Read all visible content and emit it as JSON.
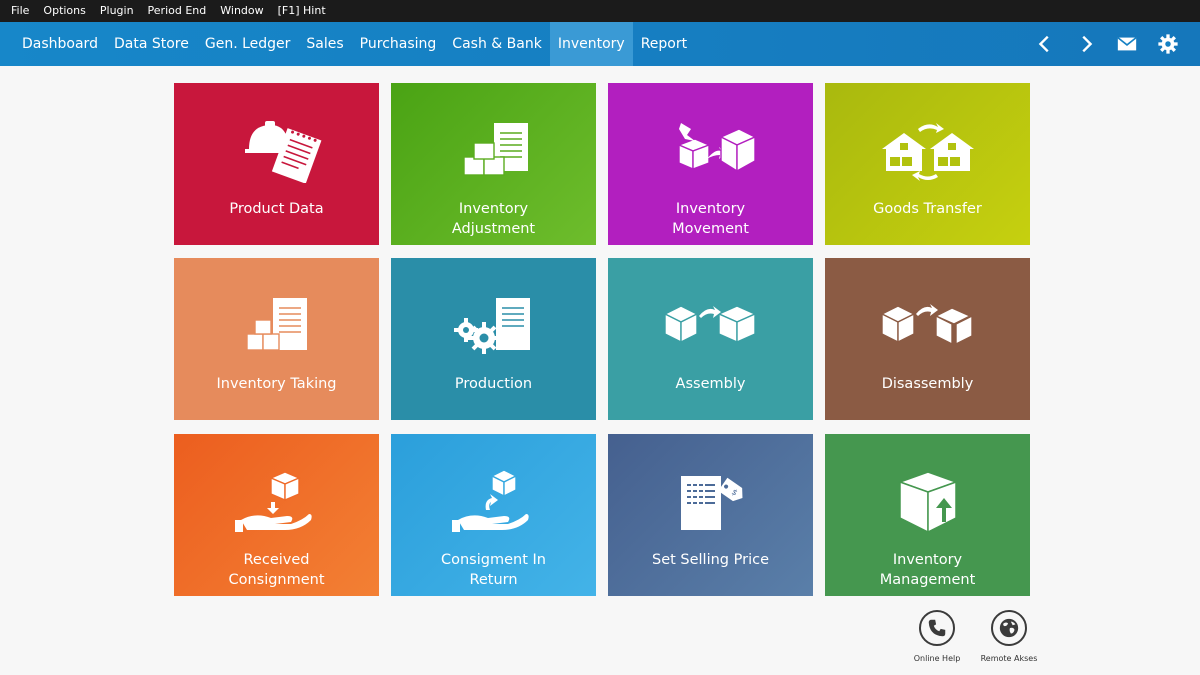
{
  "menubar": {
    "items": [
      "File",
      "Options",
      "Plugin",
      "Period End",
      "Window",
      "[F1] Hint"
    ]
  },
  "navbar": {
    "tabs": [
      "Dashboard",
      "Data Store",
      "Gen. Ledger",
      "Sales",
      "Purchasing",
      "Cash & Bank",
      "Inventory",
      "Report"
    ],
    "active_tab": "Inventory",
    "icons": [
      "chevron-left-icon",
      "chevron-right-icon",
      "mail-icon",
      "gear-icon"
    ]
  },
  "colors": {
    "menubar_bg": "#1b1b1b",
    "navbar_bg": "#1681c4",
    "active_tab_bg": "#3a9ad5",
    "page_bg": "#f7f7f7"
  },
  "tiles": [
    {
      "label": "Product Data",
      "icon": "hardhat-notepad-icon",
      "color": "#c8173c"
    },
    {
      "label": "Inventory\nAdjustment",
      "icon": "boxes-checklist-icon",
      "color": "#5aac1e"
    },
    {
      "label": "Inventory\nMovement",
      "icon": "box-arrow-box-icon",
      "color": "#b21fbf"
    },
    {
      "label": "Goods Transfer",
      "icon": "warehouse-exchange-icon",
      "color": "#b2c20e"
    },
    {
      "label": "Inventory Taking",
      "icon": "boxes-notepad-icon",
      "color": "#e68b5c"
    },
    {
      "label": "Production",
      "icon": "gears-notepad-icon",
      "color": "#2a8ea8"
    },
    {
      "label": "Assembly",
      "icon": "cubes-assemble-icon",
      "color": "#3a9fa4"
    },
    {
      "label": "Disassembly",
      "icon": "cubes-disassemble-icon",
      "color": "#8b5b44"
    },
    {
      "label": "Received\nConsignment",
      "icon": "hand-receive-box-icon",
      "color": "#ef6a28"
    },
    {
      "label": "Consigment In\nReturn",
      "icon": "hand-return-box-icon",
      "color": "#36a8e0"
    },
    {
      "label": "Set Selling Price",
      "icon": "price-tag-icon",
      "color": "#4c6b98"
    },
    {
      "label": "Inventory\nManagement",
      "icon": "box-upload-icon",
      "color": "#45974f"
    }
  ],
  "bottom_buttons": [
    {
      "label": "Online Help",
      "icon": "phone-icon"
    },
    {
      "label": "Remote Akses",
      "icon": "globe-icon"
    }
  ]
}
